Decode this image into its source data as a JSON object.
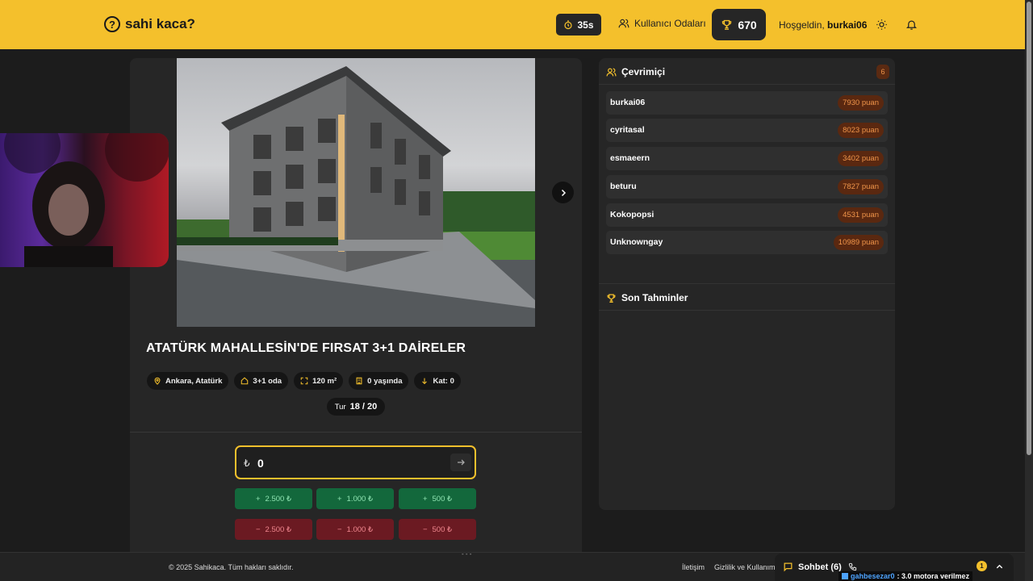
{
  "header": {
    "logo_icon": "?",
    "logo_text": "sahi kaca?",
    "timer": "35s",
    "rooms_label": "Kullanıcı Odaları",
    "score": "670",
    "welcome_prefix": "Hoşgeldin,",
    "username": "burkai06",
    "colors": {
      "brand": "#f4c02c",
      "dark": "#262626"
    }
  },
  "listing": {
    "title": "ATATÜRK MAHALLESİN'DE FIRSAT 3+1 DAİRELER",
    "chips": [
      {
        "icon": "location-pin-icon",
        "label": "Ankara, Atatürk"
      },
      {
        "icon": "house-icon",
        "label": "3+1 oda"
      },
      {
        "icon": "area-expand-icon",
        "label": "120 m²"
      },
      {
        "icon": "building-age-icon",
        "label": "0 yaşında"
      },
      {
        "icon": "floor-arrow-icon",
        "label": "Kat: 0"
      }
    ],
    "round_label": "Tur",
    "round_value": "18 / 20"
  },
  "guess": {
    "currency": "₺",
    "value": "0",
    "buttons_plus": [
      "2.500 ₺",
      "1.000 ₺",
      "500 ₺"
    ],
    "buttons_minus": [
      "2.500 ₺",
      "1.000 ₺",
      "500 ₺"
    ],
    "colors": {
      "plus": "#13683c",
      "minus": "#6b1a22"
    }
  },
  "online": {
    "title": "Çevrimiçi",
    "count": "6",
    "users": [
      {
        "name": "burkai06",
        "points": "7930 puan"
      },
      {
        "name": "cyritasal",
        "points": "8023 puan"
      },
      {
        "name": "esmaeern",
        "points": "3402 puan"
      },
      {
        "name": "beturu",
        "points": "7827 puan"
      },
      {
        "name": "Kokopopsi",
        "points": "4531 puan"
      },
      {
        "name": "Unknowngay",
        "points": "10989 puan"
      }
    ]
  },
  "recent": {
    "title": "Son Tahminler"
  },
  "footer": {
    "copyright": "© 2025 Sahikaca. Tüm hakları saklıdır.",
    "contact": "İletişim",
    "privacy": "Gizlilik ve Kullanım"
  },
  "chat": {
    "label": "Sohbet (6)",
    "unread": "1",
    "last_from": "gahbesezar0",
    "last_message": ": 3.0 motora verilmez"
  }
}
